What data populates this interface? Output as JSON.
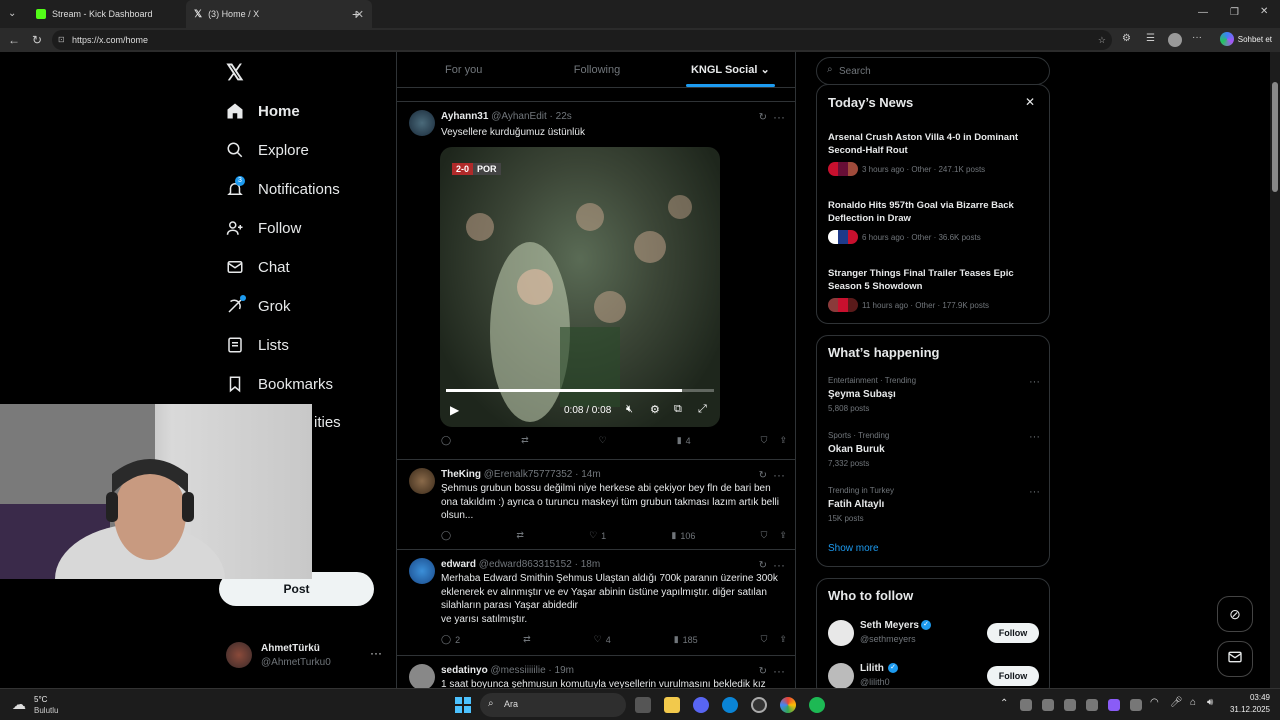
{
  "browser": {
    "tabs": [
      {
        "title": "Stream - Kick Dashboard",
        "active": false
      },
      {
        "title": "(3) Home / X",
        "active": true
      }
    ],
    "url": "https://x.com/home",
    "sohbet_label": "Sohbet et"
  },
  "sidebar": {
    "items": [
      {
        "label": "Home",
        "icon": "home-icon"
      },
      {
        "label": "Explore",
        "icon": "search-icon"
      },
      {
        "label": "Notifications",
        "icon": "bell-icon",
        "badge": "3"
      },
      {
        "label": "Follow",
        "icon": "person-add-icon"
      },
      {
        "label": "Chat",
        "icon": "mail-icon"
      },
      {
        "label": "Grok",
        "icon": "grok-icon"
      },
      {
        "label": "Lists",
        "icon": "list-icon"
      },
      {
        "label": "Bookmarks",
        "icon": "bookmark-icon"
      },
      {
        "label": "ities",
        "icon": "communities-icon"
      }
    ],
    "post_button": "Post",
    "account": {
      "name": "AhmetTürkü",
      "handle": "@AhmetTurku0"
    }
  },
  "timeline": {
    "tabs": [
      {
        "label": "For you"
      },
      {
        "label": "Following"
      },
      {
        "label": "KNGL Social",
        "selected": true
      }
    ],
    "tweets": [
      {
        "name": "Ayhann31",
        "handle": "@AyhanEdit",
        "time": "· 22s",
        "text": "Veysellere kurduğumuz üstünlük",
        "video": {
          "score": "2-0",
          "team": "POR",
          "time": "0:08 / 0:08",
          "progress": 0.88
        },
        "stats": {
          "replies": "",
          "reposts": "",
          "likes": "",
          "views": "4"
        }
      },
      {
        "name": "TheKing",
        "handle": "@Erenalk75777352",
        "time": "· 14m",
        "text": "Şehmus grubun bossu değilmi niye herkese abi çekiyor bey fln de  bari ben ona takıldım :) ayrıca o turuncu maskeyi tüm grubun  takması lazım artık belli olsun...",
        "stats": {
          "replies": "",
          "reposts": "",
          "likes": "1",
          "views": "106"
        }
      },
      {
        "name": "edward",
        "handle": "@edward863315152",
        "time": "· 18m",
        "text": "Merhaba Edward Smithin Şehmus Ulaştan aldığı 700k paranın üzerine 300k eklenerek ev alınmıştır ve ev Yaşar abinin üstüne yapılmıştır. diğer satılan silahların parası Yaşar abidedir\nve yarısı satılmıştır.",
        "stats": {
          "replies": "2",
          "reposts": "",
          "likes": "4",
          "views": "185"
        }
      },
      {
        "name": "sedatinyo",
        "handle": "@messiiiiilie",
        "time": "· 19m",
        "text": "1 saat boyunca şehmusun komutuyla veysellerin vurulmasını bekledik kız"
      }
    ]
  },
  "right": {
    "search_placeholder": "Search",
    "news": {
      "title": "Today’s News",
      "items": [
        {
          "title": "Arsenal Crush Aston Villa 4-0 in Dominant Second-Half Rout",
          "meta": "3 hours ago · Other · 247.1K posts"
        },
        {
          "title": "Ronaldo Hits 957th Goal via Bizarre Back Deflection in Draw",
          "meta": "6 hours ago · Other · 36.6K posts"
        },
        {
          "title": "Stranger Things Final Trailer Teases Epic Season 5 Showdown",
          "meta": "11 hours ago · Other · 177.9K posts"
        }
      ]
    },
    "happening": {
      "title": "What’s happening",
      "items": [
        {
          "category": "Entertainment · Trending",
          "name": "Şeyma Subaşı",
          "posts": "5,808 posts"
        },
        {
          "category": "Sports · Trending",
          "name": "Okan Buruk",
          "posts": "7,332 posts"
        },
        {
          "category": "Trending in Turkey",
          "name": "Fatih Altaylı",
          "posts": "15K posts"
        }
      ],
      "show_more": "Show more"
    },
    "who_to_follow": {
      "title": "Who to follow",
      "items": [
        {
          "name": "Seth Meyers",
          "handle": "@sethmeyers",
          "button": "Follow"
        },
        {
          "name": "Lilith",
          "handle": "@lilith0",
          "button": "Follow"
        }
      ]
    }
  },
  "taskbar": {
    "weather_temp": "5°C",
    "weather_desc": "Bulutlu",
    "search_label": "Ara",
    "time": "03:49",
    "date": "31.12.2025"
  },
  "colors": {
    "accent": "#1d9bf0",
    "background": "#000000",
    "border": "#2f3336",
    "muted": "#71767b"
  }
}
